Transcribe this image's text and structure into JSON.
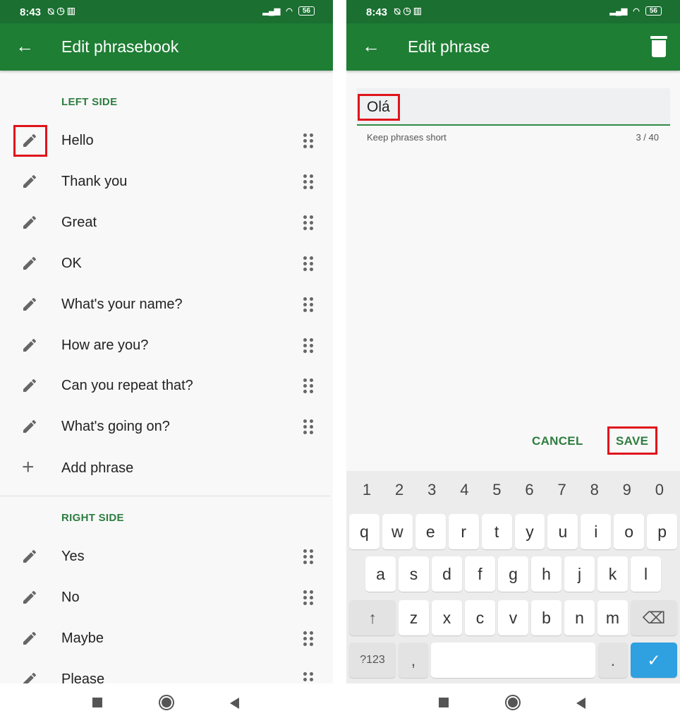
{
  "status_bar": {
    "time": "8:43",
    "battery": "56"
  },
  "left_screen": {
    "title": "Edit phrasebook",
    "left_side": {
      "header": "LEFT SIDE",
      "phrases": [
        "Hello",
        "Thank you",
        "Great",
        "OK",
        "What's your name?",
        "How are you?",
        "Can you repeat that?",
        "What's going on?"
      ],
      "add_label": "Add phrase"
    },
    "right_side": {
      "header": "RIGHT SIDE",
      "phrases": [
        "Yes",
        "No",
        "Maybe",
        "Please"
      ]
    }
  },
  "right_screen": {
    "title": "Edit phrase",
    "field_value": "Olá",
    "helper": "Keep phrases short",
    "counter": "3 / 40",
    "cancel": "CANCEL",
    "save": "SAVE",
    "keyboard": {
      "numbers": [
        "1",
        "2",
        "3",
        "4",
        "5",
        "6",
        "7",
        "8",
        "9",
        "0"
      ],
      "row1": [
        "q",
        "w",
        "e",
        "r",
        "t",
        "y",
        "u",
        "i",
        "o",
        "p"
      ],
      "row2": [
        "a",
        "s",
        "d",
        "f",
        "g",
        "h",
        "j",
        "k",
        "l"
      ],
      "row3": [
        "z",
        "x",
        "c",
        "v",
        "b",
        "n",
        "m"
      ],
      "symbols": "?123",
      "comma": ",",
      "period": "."
    }
  },
  "colors": {
    "app_bar": "#1e7e34",
    "accent": "#2e7d40",
    "highlight": "#e0141b",
    "enter_key": "#2fa0e0"
  }
}
